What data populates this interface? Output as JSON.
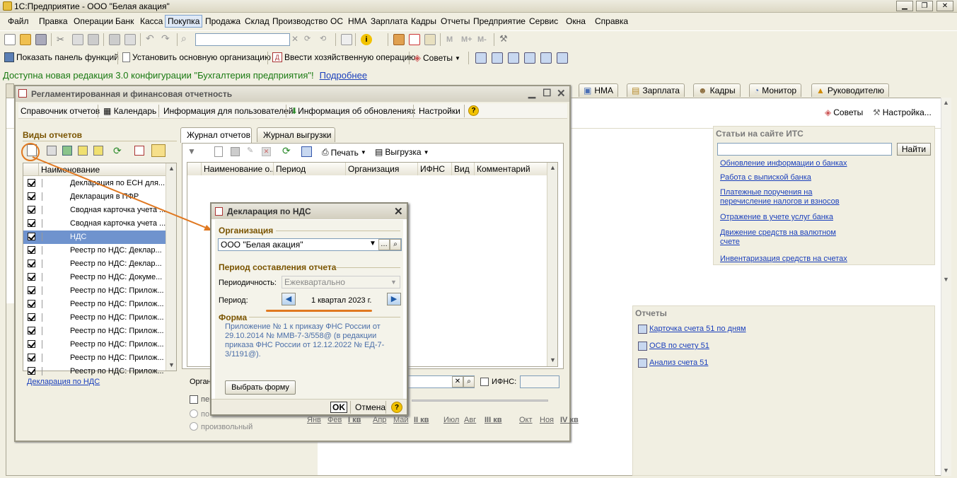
{
  "app": {
    "title": "1С:Предприятие - ООО \"Белая акация\""
  },
  "menu": [
    "Файл",
    "Правка",
    "Операции",
    "Банк",
    "Касса",
    "Покупка",
    "Продажа",
    "Склад",
    "Производство",
    "ОС",
    "НМА",
    "Зарплата",
    "Кадры",
    "Отчеты",
    "Предприятие",
    "Сервис",
    "Окна",
    "Справка"
  ],
  "menu_active": "Покупка",
  "toolbar2": {
    "show_panel": "Показать панель функций",
    "set_org": "Установить основную организацию",
    "enter_op": "Ввести хозяйственную операцию",
    "tips": "Советы"
  },
  "notice": {
    "text": "Доступна новая редакция 3.0 конфигурации \"Бухгалтерия предприятия\"!",
    "link": "Подробнее"
  },
  "main_tabs": [
    "НМА",
    "Зарплата",
    "Кадры",
    "Монитор",
    "Руководителю"
  ],
  "main_tools": {
    "tips": "Советы",
    "settings": "Настройка..."
  },
  "its": {
    "title": "Статьи на сайте ИТС",
    "find": "Найти",
    "links": [
      "Обновление информации о банках",
      "Работа с выпиской банка",
      "Платежные поручения на перечисление налогов и взносов",
      "Отражение в учете услуг банка",
      "Движение средств на валютном счете",
      "Инвентаризация средств на счетах"
    ]
  },
  "reports": {
    "title": "Отчеты",
    "links": [
      "Карточка счета 51 по дням",
      "ОСВ по счету 51",
      "Анализ счета 51"
    ]
  },
  "window": {
    "title": "Регламентированная и финансовая отчетность",
    "toolbar": {
      "ref": "Справочник отчетов",
      "cal": "Календарь",
      "info": "Информация для пользователей",
      "upd": "Информация об обновлениях",
      "settings": "Настройки"
    },
    "kinds_title": "Виды отчетов",
    "col_name": "Наименование",
    "rows": [
      "Декларация по ЕСН для...",
      "Декларация в ПФР",
      "Сводная карточка учета ...",
      "Сводная карточка учета ...",
      "НДС",
      "Реестр по НДС: Деклар...",
      "Реестр по НДС: Деклар...",
      "Реестр по НДС: Докуме...",
      "Реестр по НДС: Прилож...",
      "Реестр по НДС: Прилож...",
      "Реестр по НДС: Прилож...",
      "Реестр по НДС: Прилож...",
      "Реестр по НДС: Прилож...",
      "Реестр по НДС: Прилож...",
      "Реестр по НДС: Прилож..."
    ],
    "selected_row": 4,
    "footer_link": "Декларация по НДС",
    "tabs": [
      "Журнал отчетов",
      "Журнал выгрузки"
    ],
    "journal_tb": {
      "print": "Печать",
      "export": "Выгрузка"
    },
    "columns": [
      "Наименование о...",
      "Период",
      "Организация",
      "ИФНС",
      "Вид",
      "Комментарий"
    ],
    "org_label": "Орган",
    "ifns_label": "ИФНС:",
    "period_opts": [
      "пер",
      "по",
      "произвольный"
    ],
    "months": [
      "Янв",
      "Фев",
      "I кв",
      "Апр",
      "Май",
      "II кв",
      "Июл",
      "Авг",
      "III кв",
      "Окт",
      "Ноя",
      "IV кв"
    ]
  },
  "dialog": {
    "title": "Декларация по НДС",
    "org_section": "Организация",
    "org_value": "ООО \"Белая акация\"",
    "period_section": "Период составления отчета",
    "periodicity_label": "Периодичность:",
    "periodicity_value": "Ежеквартально",
    "period_label": "Период:",
    "period_value": "1 квартал 2023 г.",
    "form_section": "Форма",
    "form_text": "Приложение № 1 к приказу ФНС России от 29.10.2014 № ММВ-7-3/558@ (в редакции приказа ФНС России от 12.12.2022 № ЕД-7-3/1191@).",
    "choose_form": "Выбрать форму",
    "ok": "OK",
    "cancel": "Отмена"
  },
  "colors": {
    "accent": "#e07820",
    "link": "#1a3fbc",
    "section": "#7a5400",
    "notice": "#1a7a12",
    "selected": "#6f93ce"
  }
}
